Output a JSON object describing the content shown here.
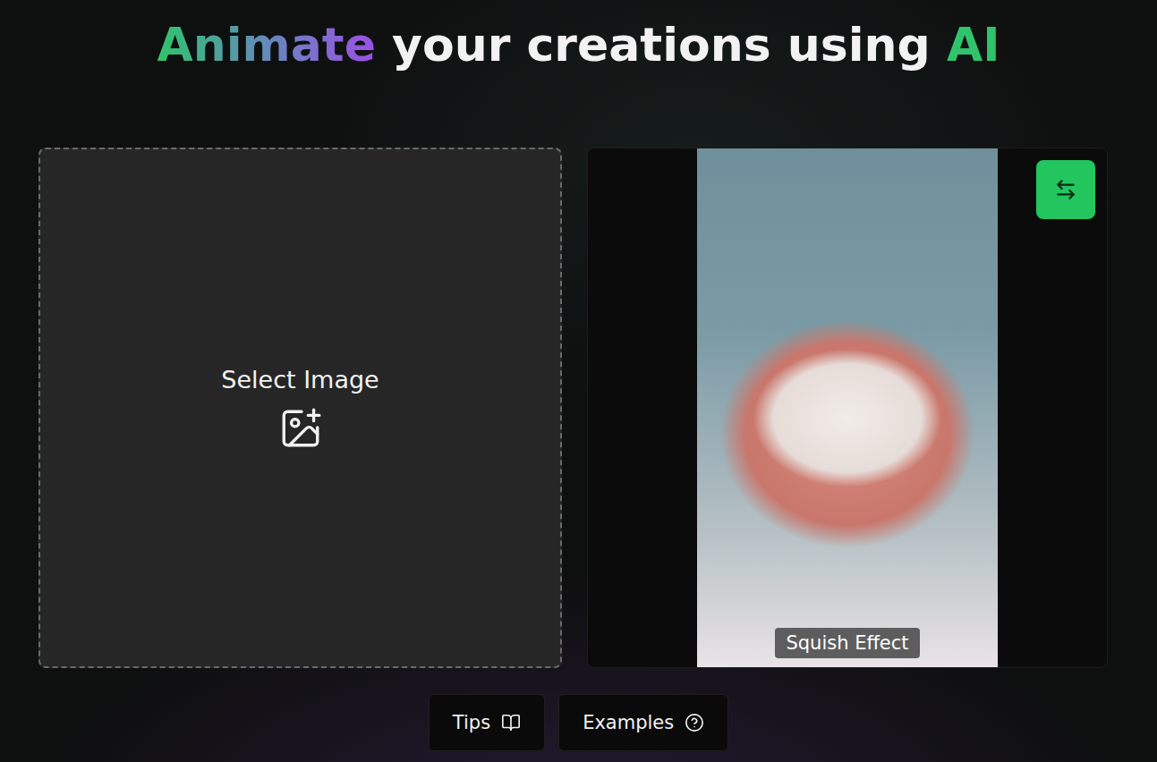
{
  "title": [
    {
      "text": "Animate",
      "kind": "gradient"
    },
    {
      "text": " your creations using ",
      "kind": "plain"
    },
    {
      "text": "AI",
      "kind": "accent"
    }
  ],
  "upload": {
    "label": "Select Image"
  },
  "preview": {
    "caption": "Squish Effect"
  },
  "buttons": [
    {
      "label": "Tips",
      "kind": "guide"
    },
    {
      "label": "Examples",
      "kind": "help"
    }
  ]
}
